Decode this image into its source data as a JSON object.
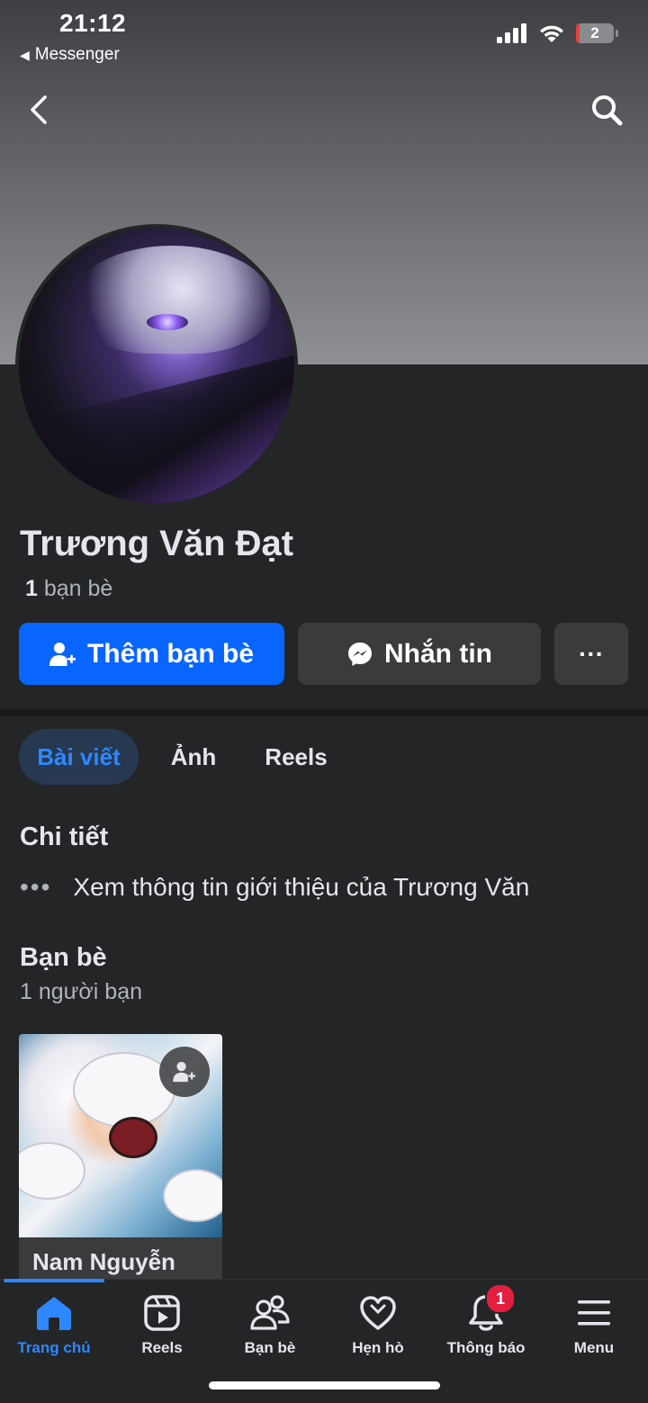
{
  "status_bar": {
    "time": "21:12",
    "back_app": "Messenger",
    "battery": "2"
  },
  "profile": {
    "name": "Trương Văn Đạt",
    "friend_count": "1",
    "friend_count_label": "bạn bè"
  },
  "actions": {
    "add_friend": "Thêm bạn bè",
    "message": "Nhắn tin",
    "more": "···"
  },
  "tabs": [
    {
      "label": "Bài viết",
      "active": true
    },
    {
      "label": "Ảnh",
      "active": false
    },
    {
      "label": "Reels",
      "active": false
    }
  ],
  "details": {
    "title": "Chi tiết",
    "intro_text": "Xem thông tin giới thiệu của Trương Văn"
  },
  "friends": {
    "title": "Bạn bè",
    "subtitle": "1 người bạn",
    "items": [
      {
        "name": "Nam Nguyễn"
      }
    ]
  },
  "bottom_nav": [
    {
      "label": "Trang chủ",
      "icon": "home-icon",
      "active": true
    },
    {
      "label": "Reels",
      "icon": "reels-icon"
    },
    {
      "label": "Bạn bè",
      "icon": "friends-icon"
    },
    {
      "label": "Hẹn hò",
      "icon": "dating-heart-icon"
    },
    {
      "label": "Thông báo",
      "icon": "bell-icon",
      "badge": "1"
    },
    {
      "label": "Menu",
      "icon": "menu-icon"
    }
  ],
  "colors": {
    "accent": "#0866ff",
    "active_blue": "#2d88ff",
    "background": "#242526",
    "badge_red": "#e41e3f"
  }
}
